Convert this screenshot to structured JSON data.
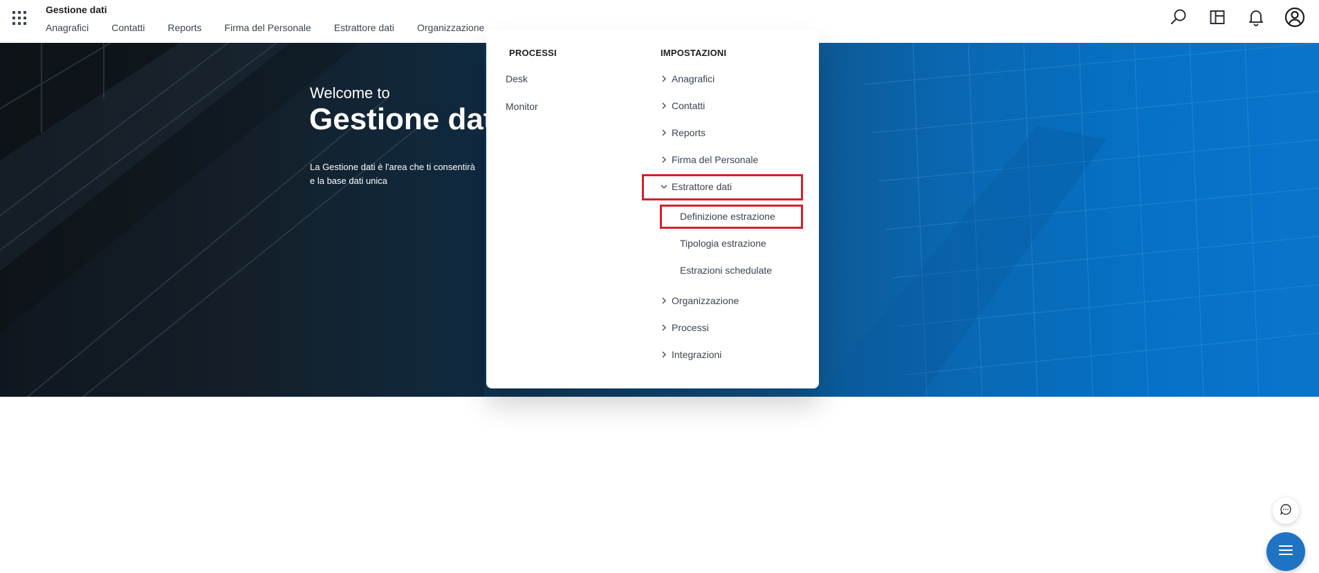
{
  "header": {
    "app_title": "Gestione dati",
    "nav": [
      {
        "label": "Anagrafici"
      },
      {
        "label": "Contatti"
      },
      {
        "label": "Reports"
      },
      {
        "label": "Firma del Personale"
      },
      {
        "label": "Estrattore dati"
      },
      {
        "label": "Organizzazione"
      }
    ],
    "icons": [
      "apps-grid-icon",
      "search-icon",
      "layout-panel-icon",
      "bell-icon",
      "user-avatar-icon"
    ]
  },
  "hero": {
    "welcome": "Welcome to",
    "title": "Gestione dati",
    "desc_line1": "La Gestione dati è l'area che ti consentirà",
    "desc_line2": "e la base dati unica"
  },
  "menu": {
    "processi": {
      "heading": "PROCESSI",
      "items": [
        {
          "label": "Desk"
        },
        {
          "label": "Monitor"
        }
      ]
    },
    "impostazioni": {
      "heading": "IMPOSTAZIONI",
      "items": [
        {
          "label": "Anagrafici",
          "expanded": false
        },
        {
          "label": "Contatti",
          "expanded": false
        },
        {
          "label": "Reports",
          "expanded": false
        },
        {
          "label": "Firma del Personale",
          "expanded": false
        },
        {
          "label": "Estrattore dati",
          "expanded": true
        },
        {
          "label": "Organizzazione",
          "expanded": false
        },
        {
          "label": "Processi",
          "expanded": false
        },
        {
          "label": "Integrazioni",
          "expanded": false
        }
      ],
      "estrattore_sub": [
        {
          "label": "Definizione estrazione",
          "highlighted": true
        },
        {
          "label": "Tipologia estrazione"
        },
        {
          "label": "Estrazioni schedulate"
        }
      ]
    }
  },
  "colors": {
    "highlight_border": "#d81e2a",
    "fab_blue": "#1f73c2",
    "hero_blue": "#0572c7"
  }
}
